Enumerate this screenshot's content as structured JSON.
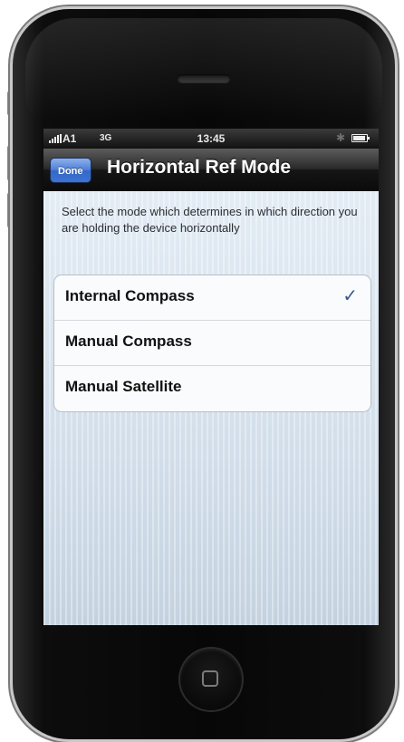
{
  "status_bar": {
    "carrier": "A1",
    "network": "3G",
    "time": "13:45"
  },
  "nav": {
    "done_label": "Done",
    "title": "Horizontal Ref Mode"
  },
  "description": "Select the mode which determines in which direction you are holding the device horizontally",
  "options": [
    {
      "label": "Internal Compass",
      "selected": true
    },
    {
      "label": "Manual Compass",
      "selected": false
    },
    {
      "label": "Manual Satellite",
      "selected": false
    }
  ],
  "icons": {
    "check": "checkmark-icon",
    "bluetooth": "bluetooth-icon",
    "battery": "battery-icon",
    "signal": "signal-bars-icon",
    "home": "home-button-icon"
  },
  "colors": {
    "done_button": "#4d7fd8",
    "checkmark": "#3a5a8e",
    "content_background": "#d2deea"
  }
}
